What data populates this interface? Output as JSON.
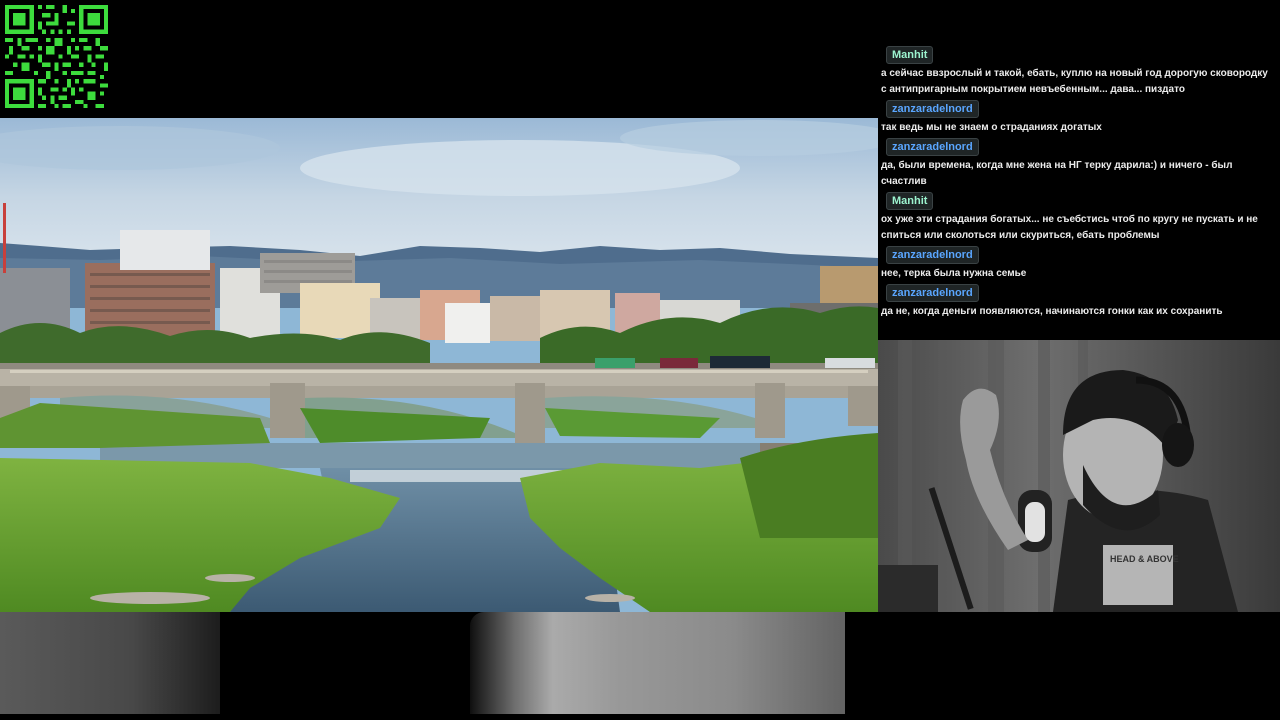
{
  "chat": {
    "messages": [
      {
        "user": "Manhit",
        "text": "а сейчас ввзрослый и такой, ебать, куплю на новый год дорогую сковородку с антипригарным покрытием невъебенным... дава... пиздато"
      },
      {
        "user": "zanzaradelnord",
        "text": "так ведь мы не знаем о страданиях догатых"
      },
      {
        "user": "zanzaradelnord",
        "text": "да, были времена, когда мне жена на НГ терку дарила:) и ничего - был счастлив"
      },
      {
        "user": "Manhit",
        "text": "ох уже эти страдания богатых... не съебстись чтоб по кругу не пускать и не спиться или сколоться или скуриться, ебать проблемы"
      },
      {
        "user": "zanzaradelnord",
        "text": "нее, терка была нужна семье"
      },
      {
        "user": "zanzaradelnord",
        "text": "да не, когда деньги появляются, начинаются гонки как их сохранить"
      }
    ]
  },
  "webcam": {
    "shirt_text": "HEAD & ABOVE"
  },
  "colors": {
    "background": "#000000",
    "qr_green": "#3ddc3d",
    "nick_green": "#9cf3cf",
    "nick_blue": "#5aa6ff"
  },
  "icons": {
    "qr": "qr-code-icon"
  }
}
